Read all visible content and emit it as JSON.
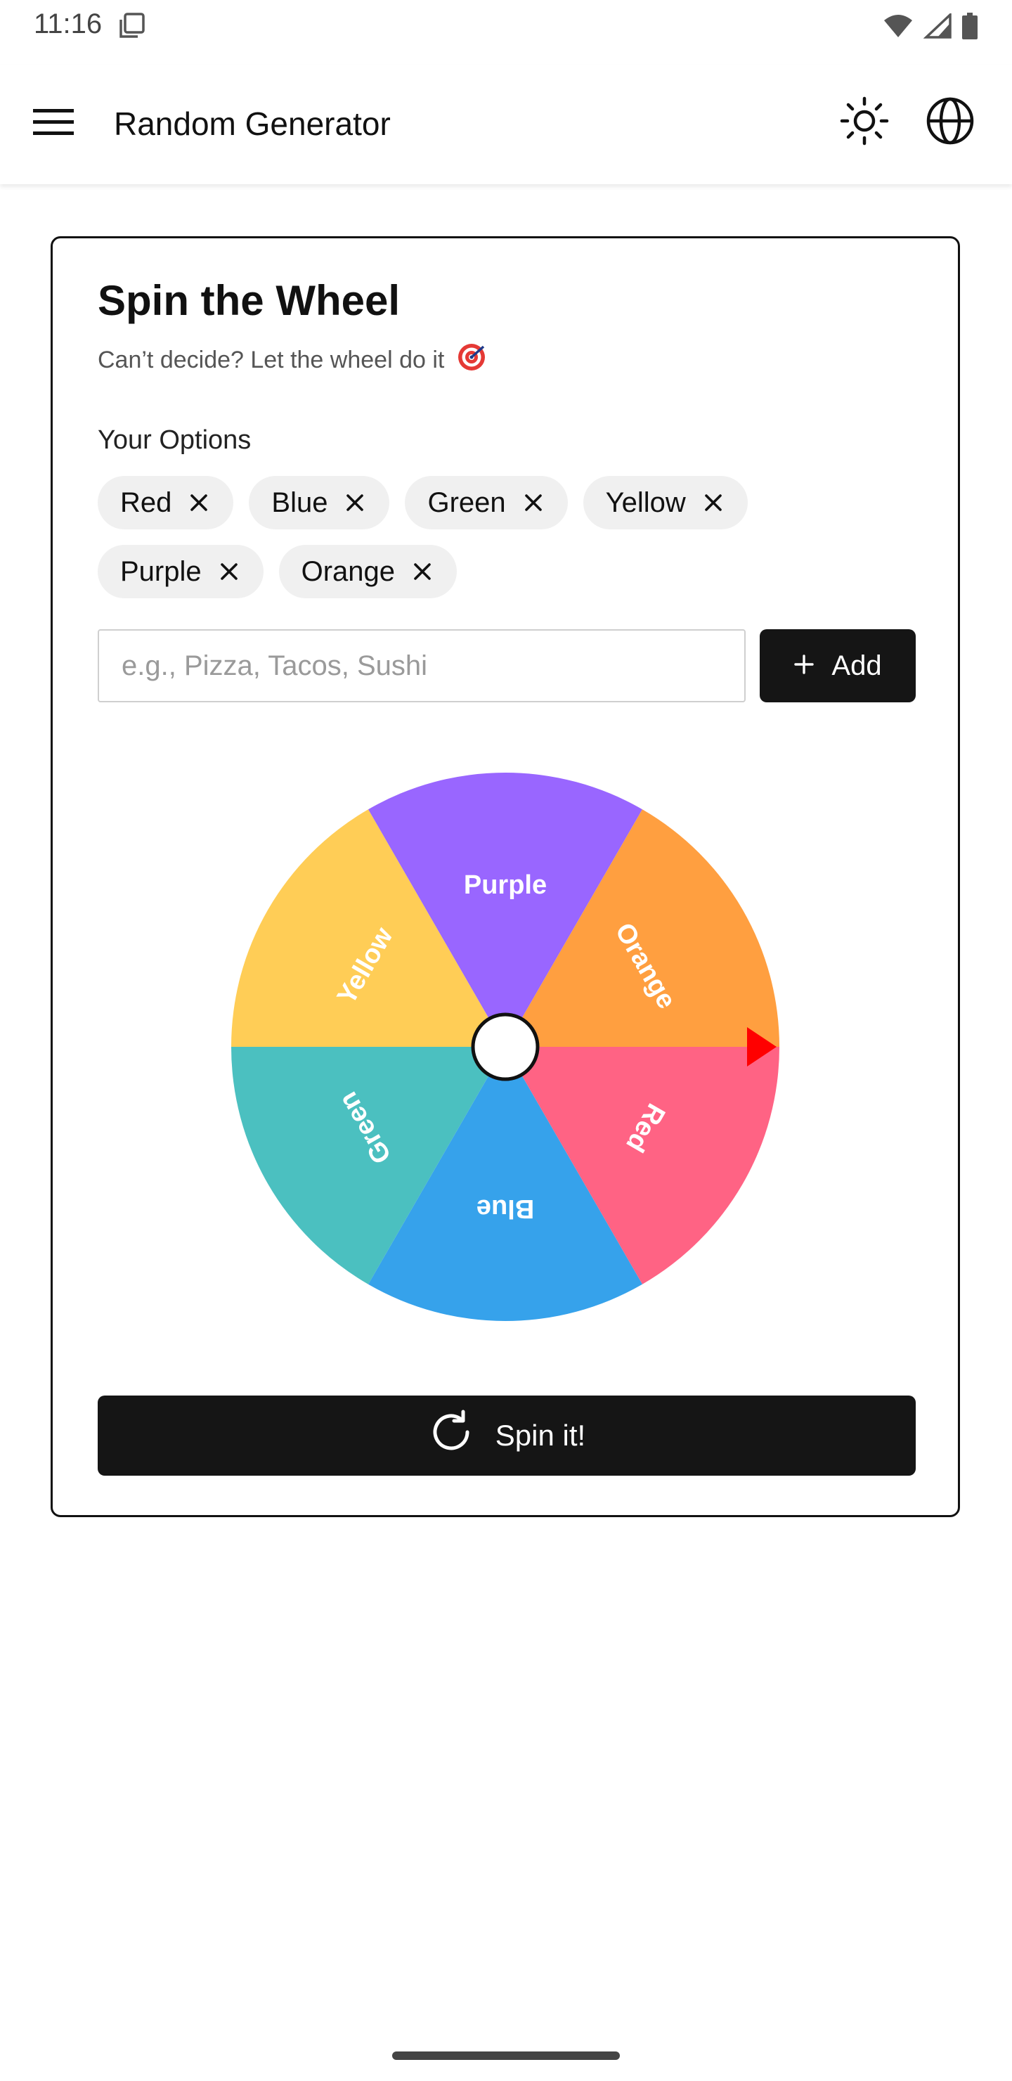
{
  "status_bar": {
    "time": "11:16"
  },
  "app_bar": {
    "title": "Random Generator",
    "menu_icon": "hamburger-menu-icon",
    "theme_icon": "sun-icon",
    "language_icon": "globe-icon"
  },
  "card": {
    "title": "Spin the Wheel",
    "subtitle": "Can’t decide? Let the wheel do it",
    "options_label": "Your Options",
    "options": [
      {
        "label": "Red"
      },
      {
        "label": "Blue"
      },
      {
        "label": "Green"
      },
      {
        "label": "Yellow"
      },
      {
        "label": "Purple"
      },
      {
        "label": "Orange"
      }
    ],
    "input": {
      "value": "",
      "placeholder": "e.g., Pizza, Tacos, Sushi"
    },
    "add_button_label": "Add",
    "spin_button_label": "Spin it!"
  },
  "wheel": {
    "segments": [
      {
        "label": "Red",
        "color": "#FF6384"
      },
      {
        "label": "Blue",
        "color": "#36A2EB"
      },
      {
        "label": "Green",
        "color": "#4BC0C0"
      },
      {
        "label": "Yellow",
        "color": "#FFCD56"
      },
      {
        "label": "Purple",
        "color": "#9966FF"
      },
      {
        "label": "Orange",
        "color": "#FF9F40"
      }
    ],
    "pointer_color": "#FF0000"
  }
}
